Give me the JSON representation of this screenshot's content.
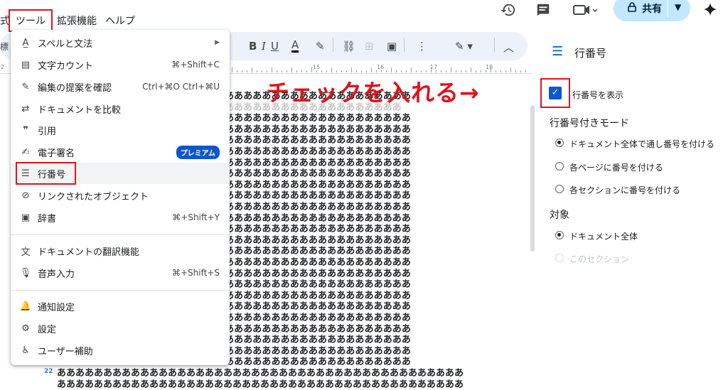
{
  "menubar": {
    "prev_fragment": "式",
    "tools": "ツール",
    "extensions": "拡張機能",
    "help": "ヘルプ"
  },
  "toolbar_top": {
    "share_label": "共有",
    "icons": [
      "history-icon",
      "comment-icon",
      "meet-icon",
      "lock-icon",
      "sparkle-icon"
    ]
  },
  "doc_toolbar": {
    "style_fragment": "標"
  },
  "ruler": {
    "numbers": [
      "2",
      "15",
      "16",
      "17",
      "18"
    ]
  },
  "dropdown": {
    "items": [
      {
        "icon": "spell-check-icon",
        "label": "スペルと文法",
        "shortcut": "",
        "submenu": true
      },
      {
        "icon": "word-count-icon",
        "label": "文字カウント",
        "shortcut": "⌘+Shift+C"
      },
      {
        "icon": "review-icon",
        "label": "編集の提案を確認",
        "shortcut": "Ctrl+⌘O Ctrl+⌘U"
      },
      {
        "icon": "compare-icon",
        "label": "ドキュメントを比較",
        "shortcut": ""
      },
      {
        "icon": "quote-icon",
        "label": "引用",
        "shortcut": ""
      },
      {
        "icon": "signature-icon",
        "label": "電子署名",
        "badge": "プレミアム"
      },
      {
        "icon": "line-numbers-icon",
        "label": "行番号",
        "shortcut": ""
      },
      {
        "icon": "linked-objects-icon",
        "label": "リンクされたオブジェクト",
        "shortcut": ""
      },
      {
        "icon": "dictionary-icon",
        "label": "辞書",
        "shortcut": "⌘+Shift+Y"
      },
      {
        "icon": "translate-icon",
        "label": "ドキュメントの翻訳機能",
        "shortcut": ""
      },
      {
        "icon": "mic-icon",
        "label": "音声入力",
        "shortcut": "⌘+Shift+S"
      },
      {
        "icon": "bell-icon",
        "label": "通知設定",
        "shortcut": ""
      },
      {
        "icon": "settings-icon",
        "label": "設定",
        "shortcut": ""
      },
      {
        "icon": "accessibility-icon",
        "label": "ユーザー補助",
        "shortcut": ""
      }
    ]
  },
  "doc": {
    "line": "ああああああああああああああああああああ",
    "line_faint": "あああああああああああああああああああ",
    "line_full": "ああああああああああああああああああああああああああああああああああああああああああああ",
    "line22_number": "22"
  },
  "sidebar": {
    "title": "行番号",
    "show_checkbox_label": "行番号を表示",
    "mode_heading": "行番号付きモード",
    "modes": [
      "ドキュメント全体で通し番号を付ける",
      "各ページに番号を付ける",
      "各セクションに番号を付ける"
    ],
    "target_heading": "対象",
    "targets": [
      "ドキュメント全体",
      "このセクション"
    ]
  },
  "annotation": {
    "text": "チェックを入れる→"
  },
  "colors": {
    "accent": "#0b57d0",
    "highlight_red": "#e0141e",
    "share_bg": "#c2e7ff",
    "toolbar_bg": "#edf2fa"
  }
}
